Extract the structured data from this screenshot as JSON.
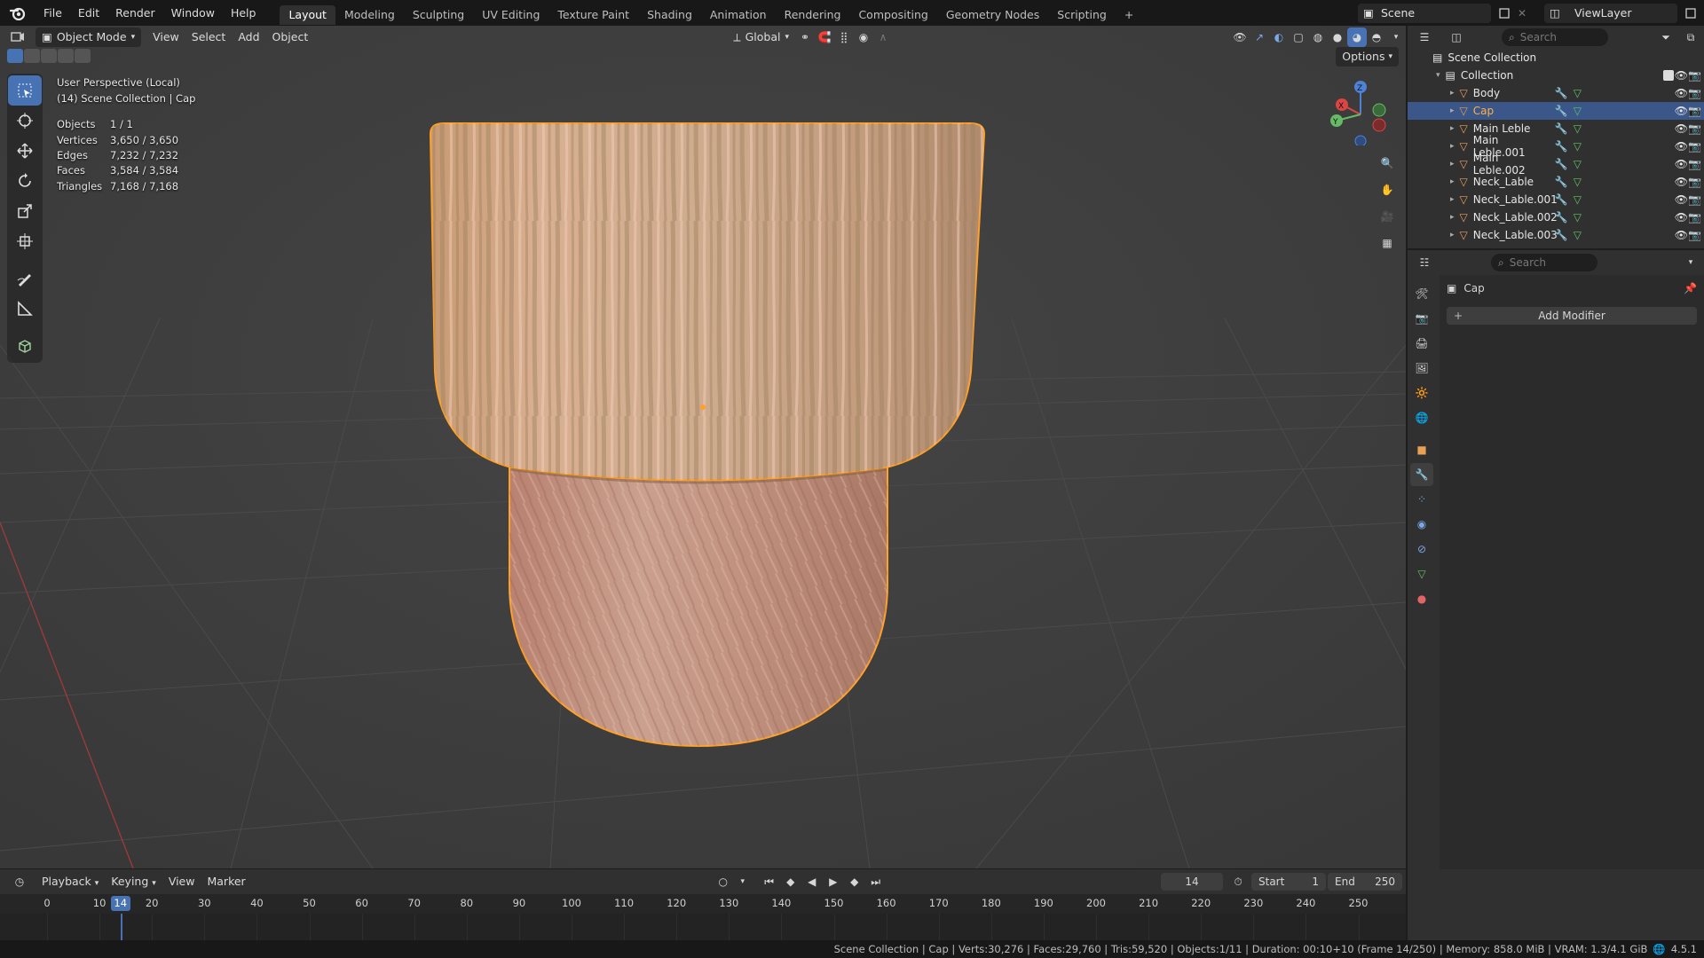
{
  "menubar": {
    "items": [
      "File",
      "Edit",
      "Render",
      "Window",
      "Help"
    ],
    "workspaces": [
      "Layout",
      "Modeling",
      "Sculpting",
      "UV Editing",
      "Texture Paint",
      "Shading",
      "Animation",
      "Rendering",
      "Compositing",
      "Geometry Nodes",
      "Scripting"
    ],
    "active_workspace": "Layout",
    "add_tab": "+",
    "scene": "Scene",
    "view_layer": "ViewLayer"
  },
  "viewport": {
    "header": {
      "mode": "Object Mode",
      "menus": [
        "View",
        "Select",
        "Add",
        "Object"
      ],
      "transform_orientation": "Global",
      "options": "Options"
    },
    "overlay": {
      "view_name": "User Perspective (Local)",
      "collection_line": "(14) Scene Collection | Cap",
      "stats": [
        {
          "label": "Objects",
          "value": "1 / 1"
        },
        {
          "label": "Vertices",
          "value": "3,650 / 3,650"
        },
        {
          "label": "Edges",
          "value": "7,232 / 7,232"
        },
        {
          "label": "Faces",
          "value": "3,584 / 3,584"
        },
        {
          "label": "Triangles",
          "value": "7,168 / 7,168"
        }
      ]
    },
    "gizmo": {
      "x": "X",
      "y": "Y",
      "z": "Z"
    }
  },
  "outliner": {
    "search_placeholder": "Search",
    "root": "Scene Collection",
    "collection": "Collection",
    "items": [
      {
        "name": "Body",
        "selected": false
      },
      {
        "name": "Cap",
        "selected": true
      },
      {
        "name": "Main Leble",
        "selected": false
      },
      {
        "name": "Main Leble.001",
        "selected": false
      },
      {
        "name": "Main Leble.002",
        "selected": false
      },
      {
        "name": "Neck_Lable",
        "selected": false
      },
      {
        "name": "Neck_Lable.001",
        "selected": false
      },
      {
        "name": "Neck_Lable.002",
        "selected": false
      },
      {
        "name": "Neck_Lable.003",
        "selected": false
      }
    ]
  },
  "properties": {
    "search_placeholder": "Search",
    "object_name": "Cap",
    "add_modifier": "Add Modifier",
    "add_modifier_icon": "+"
  },
  "timeline": {
    "menus": [
      "Playback",
      "Keying",
      "View",
      "Marker"
    ],
    "current_frame": "14",
    "start_label": "Start",
    "start_value": "1",
    "end_label": "End",
    "end_value": "250",
    "ticks": [
      "0",
      "10",
      "20",
      "30",
      "40",
      "50",
      "60",
      "70",
      "80",
      "90",
      "100",
      "110",
      "120",
      "130",
      "140",
      "150",
      "160",
      "170",
      "180",
      "190",
      "200",
      "210",
      "220",
      "230",
      "240",
      "250"
    ]
  },
  "statusbar": {
    "text": "Scene Collection | Cap | Verts:30,276 | Faces:29,760 | Tris:59,520 | Objects:1/11 | Duration: 00:10+10 (Frame 14/250) | Memory: 858.0 MiB | VRAM: 1.3/4.1 GiB",
    "version": "4.5.1"
  },
  "colors": {
    "accent": "#4772b3",
    "selection_outline": "#ffa028",
    "selected_row": "#3b5689",
    "object_icon": "#e8a055",
    "mesh_icon": "#5fc45f",
    "modifier_icon": "#7ba8e8"
  }
}
